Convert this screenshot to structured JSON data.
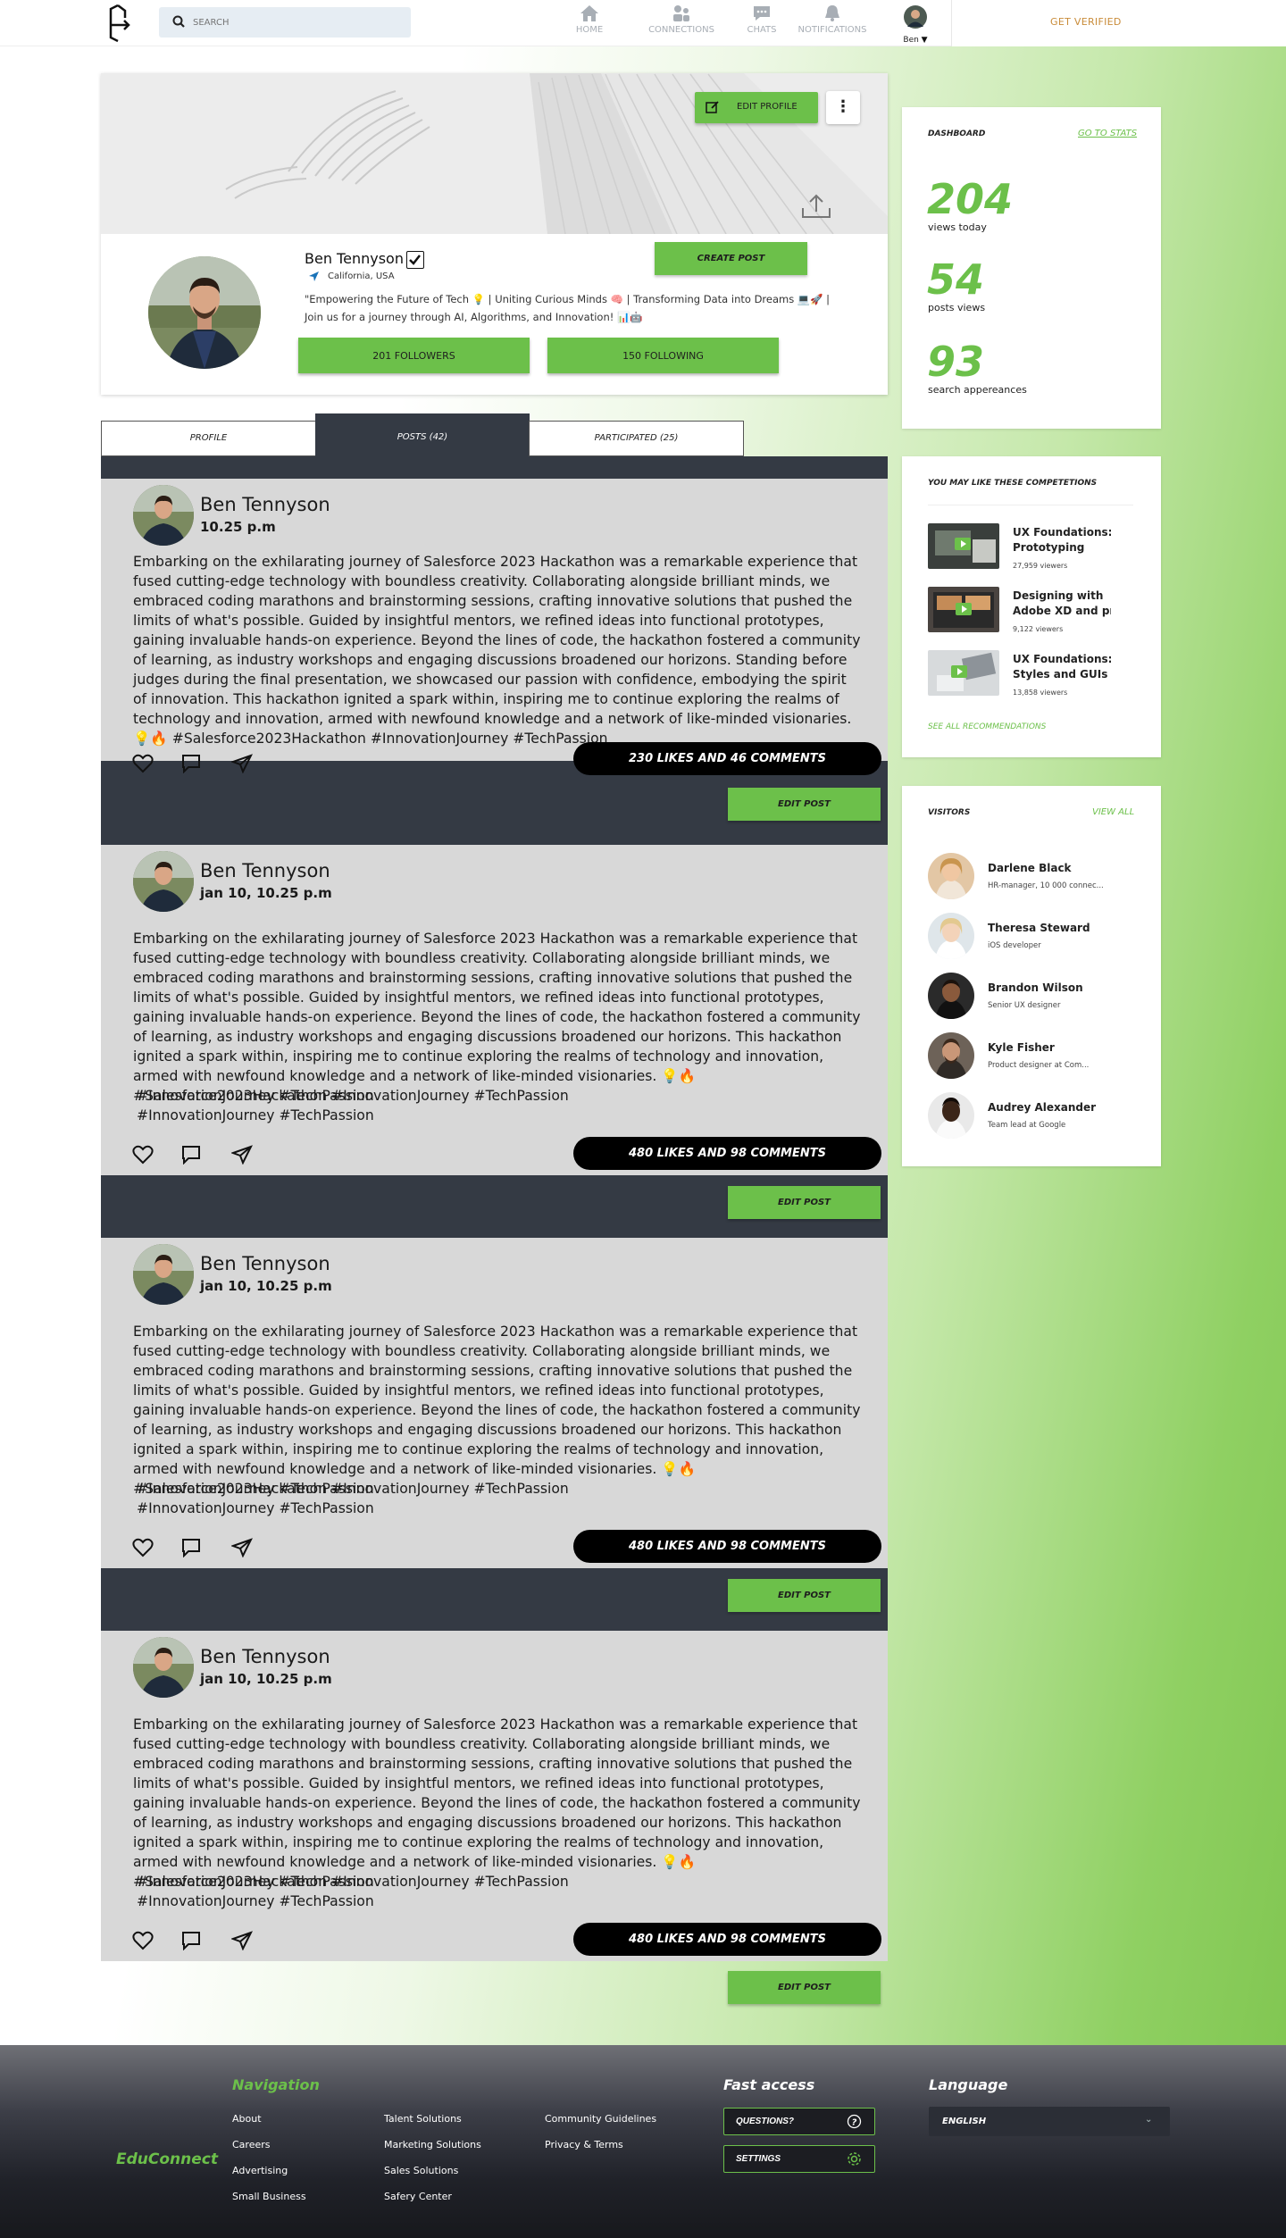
{
  "nav": {
    "search_placeholder": "SEARCH",
    "items": [
      {
        "label": "HOME",
        "icon": "home-icon"
      },
      {
        "label": "CONNECTIONS",
        "icon": "connections-icon"
      },
      {
        "label": "CHATS",
        "icon": "chat-icon"
      },
      {
        "label": "NOTIFICATIONS",
        "icon": "bell-icon"
      }
    ],
    "user_label": "Ben",
    "get_verified": "GET VERIFIED"
  },
  "profile": {
    "edit_profile": "EDIT PROFILE",
    "name": "Ben Tennyson",
    "location": "California, USA",
    "bio_line1": "\"Empowering the Future of Tech 💡 | Uniting Curious Minds 🧠 | Transforming Data into Dreams 💻🚀 |",
    "bio_line2": "Join us for a journey through AI, Algorithms, and Innovation! 📊🤖",
    "create_post": "CREATE POST",
    "followers": "201 FOLLOWERS",
    "following": "150 FOLLOWING"
  },
  "tabs": [
    {
      "label": "PROFILE",
      "active": false
    },
    {
      "label": "POSTS (42)",
      "active": true
    },
    {
      "label": "PARTICIPATED (25)",
      "active": false
    }
  ],
  "posts": [
    {
      "author": "Ben Tennyson",
      "time": "10.25 p.m",
      "text": "Embarking on the exhilarating journey of Salesforce 2023 Hackathon was a remarkable experience that fused cutting-edge technology with boundless creativity. Collaborating alongside brilliant minds, we embraced coding marathons and brainstorming sessions, crafting innovative solutions that pushed the limits of what's possible. Guided by insightful mentors, we refined ideas into functional prototypes, gaining invaluable hands-on experience. Beyond the lines of code, the hackathon fostered a community of learning, as industry workshops and engaging discussions broadened our horizons. Standing before judges during the final presentation, we showcased our passion with confidence, embodying the spirit of innovation. This hackathon ignited a spark within, inspiring me to continue exploring the realms of technology and innovation, armed with newfound knowledge and a network of like-minded visionaries. 💡🔥 #Salesforce2023Hackathon #InnovationJourney #TechPassion",
      "extra_tags": [],
      "stats": "230 LIKES  AND  46 COMMENTS",
      "edit": "EDIT POST"
    },
    {
      "author": "Ben Tennyson",
      "time": "jan 10, 10.25 p.m",
      "text": "Embarking on the exhilarating journey of Salesforce 2023 Hackathon was a remarkable experience that fused cutting-edge technology with boundless creativity. Collaborating alongside brilliant minds, we embraced coding marathons and brainstorming sessions, crafting innovative solutions that pushed the limits of what's possible. Guided by insightful mentors, we refined ideas into functional prototypes, gaining invaluable hands-on experience. Beyond the lines of code, the hackathon fostered a community of learning, as industry workshops and engaging discussions broadened our horizons. This hackathon ignited a spark within, inspiring me to continue exploring the realms of technology and innovation, armed with newfound knowledge and a network of like-minded visionaries. 💡🔥 #Salesforce2023Hackathon #InnovationJourney #TechPassion",
      "extra_tags": [
        "#InnovationJourney #TechPassion",
        "#InnovationJourney #TechPassion"
      ],
      "stats": "480 LIKES  AND  98 COMMENTS",
      "edit": "EDIT POST"
    },
    {
      "author": "Ben Tennyson",
      "time": "jan 10, 10.25 p.m",
      "text": "Embarking on the exhilarating journey of Salesforce 2023 Hackathon was a remarkable experience that fused cutting-edge technology with boundless creativity. Collaborating alongside brilliant minds, we embraced coding marathons and brainstorming sessions, crafting innovative solutions that pushed the limits of what's possible. Guided by insightful mentors, we refined ideas into functional prototypes, gaining invaluable hands-on experience. Beyond the lines of code, the hackathon fostered a community of learning, as industry workshops and engaging discussions broadened our horizons. This hackathon ignited a spark within, inspiring me to continue exploring the realms of technology and innovation, armed with newfound knowledge and a network of like-minded visionaries. 💡🔥 #Salesforce2023Hackathon #InnovationJourney #TechPassion",
      "extra_tags": [
        "#InnovationJourney #TechPassion",
        "#InnovationJourney #TechPassion"
      ],
      "stats": "480 LIKES  AND  98 COMMENTS",
      "edit": "EDIT POST"
    },
    {
      "author": "Ben Tennyson",
      "time": "jan 10, 10.25 p.m",
      "text": "Embarking on the exhilarating journey of Salesforce 2023 Hackathon was a remarkable experience that fused cutting-edge technology with boundless creativity. Collaborating alongside brilliant minds, we embraced coding marathons and brainstorming sessions, crafting innovative solutions that pushed the limits of what's possible. Guided by insightful mentors, we refined ideas into functional prototypes, gaining invaluable hands-on experience. Beyond the lines of code, the hackathon fostered a community of learning, as industry workshops and engaging discussions broadened our horizons. This hackathon ignited a spark within, inspiring me to continue exploring the realms of technology and innovation, armed with newfound knowledge and a network of like-minded visionaries. 💡🔥 #Salesforce2023Hackathon #InnovationJourney #TechPassion",
      "extra_tags": [
        "#InnovationJourney #TechPassion",
        "#InnovationJourney #TechPassion"
      ],
      "stats": "480 LIKES  AND  98 COMMENTS",
      "edit": "EDIT POST"
    }
  ],
  "dashboard": {
    "title": "DASHBOARD",
    "link": "GO TO STATS",
    "metrics": [
      {
        "value": "204",
        "label": "views today"
      },
      {
        "value": "54",
        "label": "posts views"
      },
      {
        "value": "93",
        "label": "search appereances"
      }
    ]
  },
  "competitions": {
    "title": "YOU MAY LIKE THESE COMPETETIONS",
    "items": [
      {
        "title1": "UX Foundations:",
        "title2": "Prototyping",
        "views": "27,959 viewers"
      },
      {
        "title1": "Designing with",
        "title2": "Adobe XD and pro",
        "views": "9,122 viewers"
      },
      {
        "title1": "UX Foundations:",
        "title2": "Styles and GUIs",
        "views": "13,858 viewers"
      }
    ],
    "link": "SEE ALL RECOMMENDATIONS"
  },
  "visitors": {
    "title": "VISITORS",
    "link": "VIEW ALL",
    "items": [
      {
        "name": "Darlene Black",
        "role": "HR-manager, 10 000 connec..."
      },
      {
        "name": "Theresa Steward",
        "role": "iOS developer"
      },
      {
        "name": "Brandon Wilson",
        "role": "Senior UX designer"
      },
      {
        "name": "Kyle Fisher",
        "role": "Product designer at Com..."
      },
      {
        "name": "Audrey Alexander",
        "role": "Team lead at Google"
      }
    ]
  },
  "footer": {
    "brand": "EduConnect",
    "nav_title": "Navigation",
    "col1": [
      "About",
      "Careers",
      "Advertising",
      "Small Business"
    ],
    "col2": [
      "Talent Solutions",
      "Marketing Solutions",
      "Sales Solutions",
      "Safery Center"
    ],
    "col3": [
      "Community Guidelines",
      "Privacy & Terms"
    ],
    "fast_title": "Fast access",
    "questions": "QUESTIONS?",
    "settings": "SETTINGS",
    "lang_title": "Language",
    "lang_value": "ENGLISH"
  },
  "colors": {
    "accent": "#6cc04a",
    "feed_bg": "#343a44",
    "post_bg": "#d8d8d8"
  }
}
